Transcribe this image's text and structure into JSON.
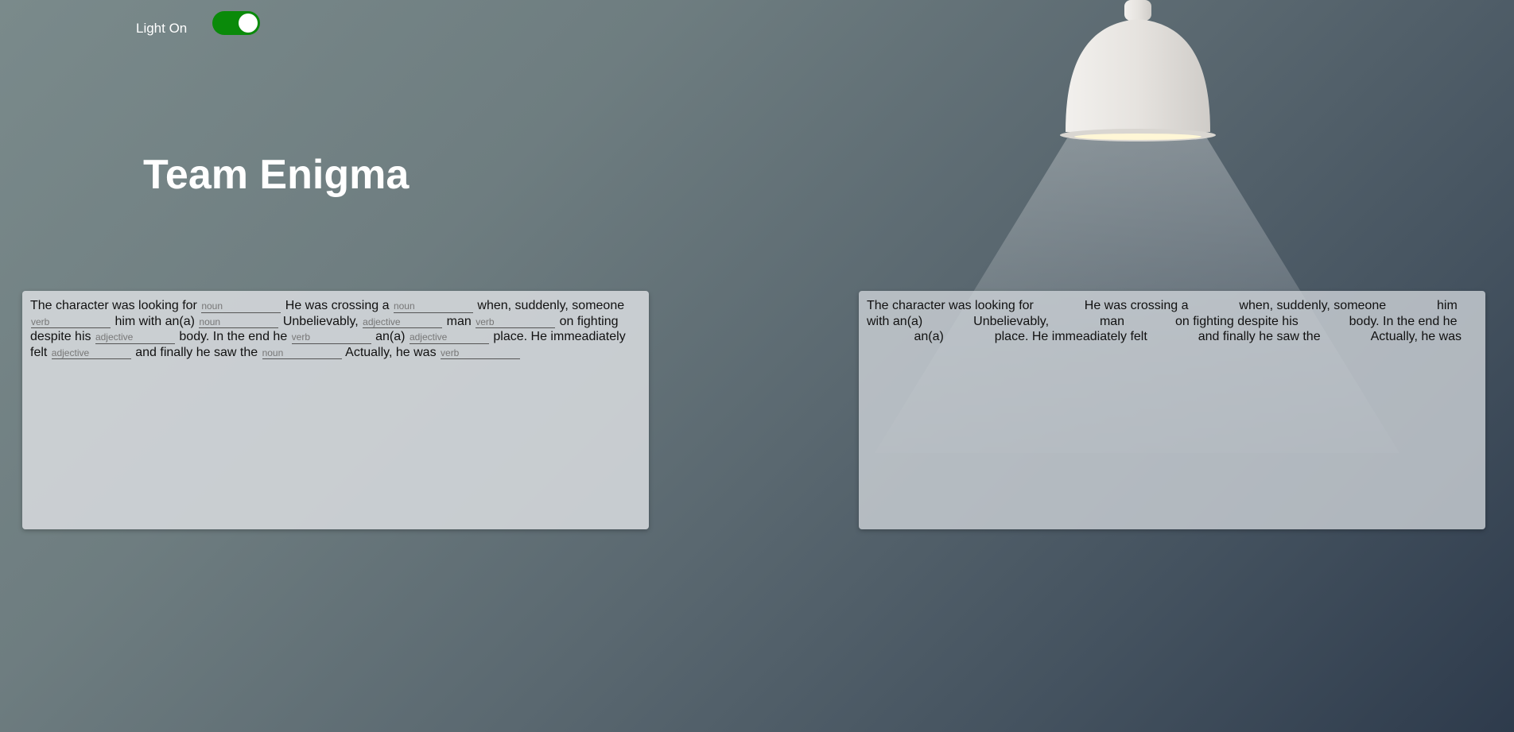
{
  "toggle": {
    "label": "Light On",
    "state": "on",
    "on_color": "#0a8a0a"
  },
  "title": "Team Enigma",
  "story": [
    {
      "type": "text",
      "value": "The character was looking for"
    },
    {
      "type": "blank",
      "placeholder": "noun",
      "value": ""
    },
    {
      "type": "text",
      "value": "He was crossing a"
    },
    {
      "type": "blank",
      "placeholder": "noun",
      "value": ""
    },
    {
      "type": "text",
      "value": "when, suddenly, someone"
    },
    {
      "type": "blank",
      "placeholder": "verb",
      "value": ""
    },
    {
      "type": "text",
      "value": "him with an(a)"
    },
    {
      "type": "blank",
      "placeholder": "noun",
      "value": ""
    },
    {
      "type": "text",
      "value": "Unbelievably,"
    },
    {
      "type": "blank",
      "placeholder": "adjective",
      "value": ""
    },
    {
      "type": "text",
      "value": "man"
    },
    {
      "type": "blank",
      "placeholder": "verb",
      "value": ""
    },
    {
      "type": "text",
      "value": "on fighting despite his"
    },
    {
      "type": "blank",
      "placeholder": "adjective",
      "value": ""
    },
    {
      "type": "text",
      "value": "body. In the end he"
    },
    {
      "type": "blank",
      "placeholder": "verb",
      "value": ""
    },
    {
      "type": "text",
      "value": "an(a)"
    },
    {
      "type": "blank",
      "placeholder": "adjective",
      "value": ""
    },
    {
      "type": "text",
      "value": "place. He immeadiately felt"
    },
    {
      "type": "blank",
      "placeholder": "adjective",
      "value": ""
    },
    {
      "type": "text",
      "value": "and finally he saw the"
    },
    {
      "type": "blank",
      "placeholder": "noun",
      "value": ""
    },
    {
      "type": "text",
      "value": "Actually, he was"
    },
    {
      "type": "blank",
      "placeholder": "verb",
      "value": ""
    }
  ],
  "lamp": {
    "icon": "pendant-lamp-icon",
    "shade_color": "#e9e6e2",
    "light_color": "#ffffff"
  }
}
